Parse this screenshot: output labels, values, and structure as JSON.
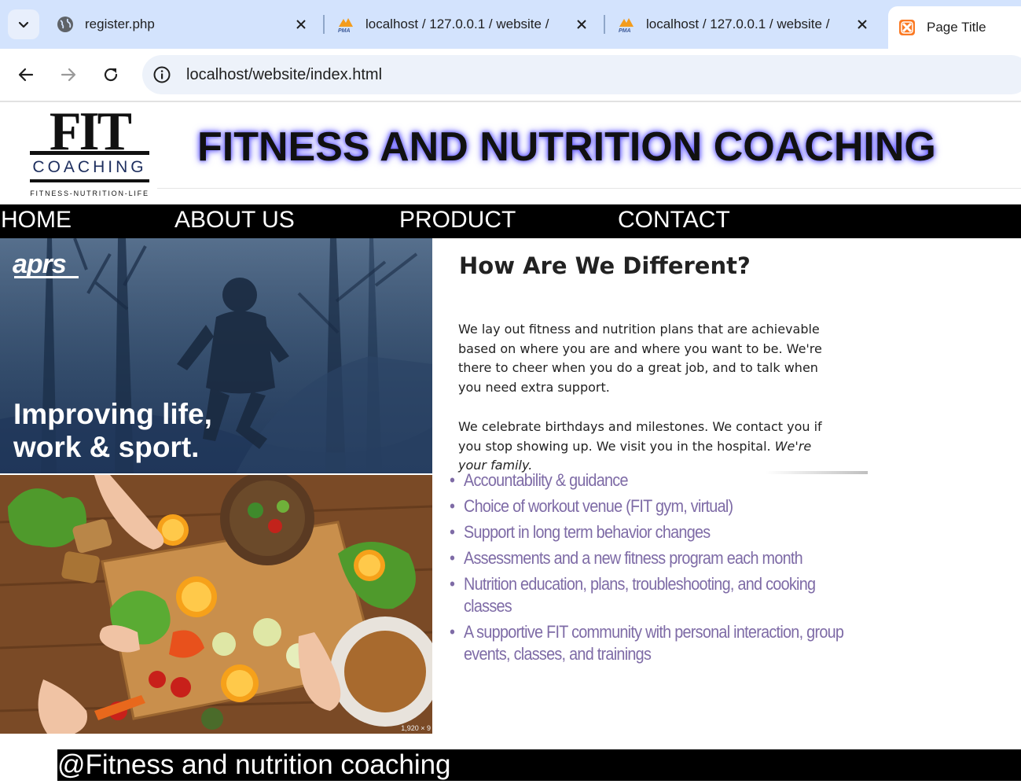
{
  "browser": {
    "tabs": [
      {
        "title": "register.php",
        "icon": "globe-icon",
        "active": false
      },
      {
        "title": "localhost / 127.0.0.1 / website /",
        "icon": "phpmyadmin-icon",
        "active": false
      },
      {
        "title": "localhost / 127.0.0.1 / website /",
        "icon": "phpmyadmin-icon",
        "active": false
      },
      {
        "title": "Page Title",
        "icon": "xampp-icon",
        "active": true
      }
    ],
    "url": "localhost/website/index.html"
  },
  "header": {
    "logo": {
      "big": "FIT",
      "sub": "COACHING",
      "tagline": "FITNESS-NUTRITION-LIFE"
    },
    "title": "FITNESS AND NUTRITION COACHING",
    "title_glow_color": "#5b52ff"
  },
  "nav": [
    {
      "label": "HOME"
    },
    {
      "label": "ABOUT US"
    },
    {
      "label": "PRODUCT"
    },
    {
      "label": "CONTACT"
    }
  ],
  "hero": {
    "brand": "aprs",
    "text_line1": "Improving life,",
    "text_line2": "work & sport."
  },
  "food_image": {
    "size_label": "1,920 × 9"
  },
  "difference": {
    "title": "How Are We Different?",
    "p1": "We lay out fitness and nutrition plans that are achievable based on where you are and where you want to be. We're there to cheer when you do a great job, and to talk when you need extra support.",
    "p2": "We celebrate birthdays and milestones. We contact you if you stop showing up. We visit you in the hospital.",
    "p2_emphasis": "We're your family."
  },
  "features": [
    "Accountability & guidance",
    "Choice of workout venue (FIT gym, virtual)",
    "Support in long term behavior changes",
    "Assessments and a new fitness program each month",
    "Nutrition education, plans, troubleshooting, and cooking",
    "classes",
    "A supportive FIT community with personal interaction, group",
    "events, classes, and trainings"
  ],
  "footer": {
    "text": "@Fitness and nutrition coaching"
  }
}
